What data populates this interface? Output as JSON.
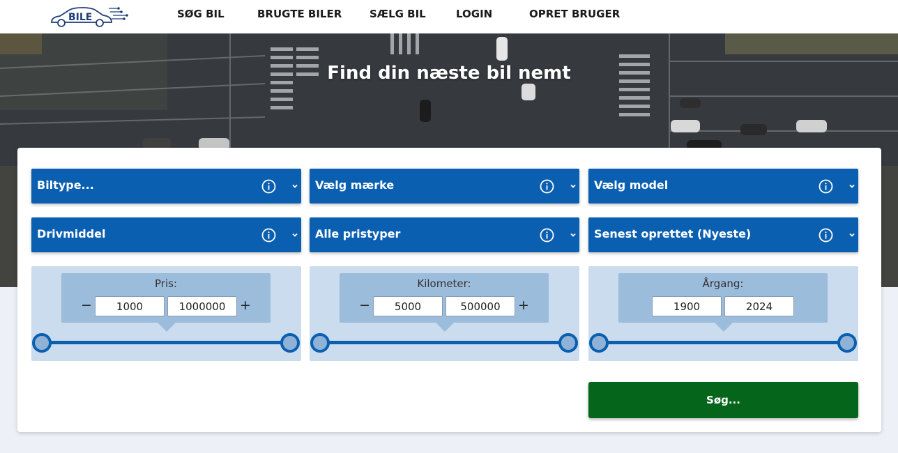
{
  "brand": {
    "logo_text": "BILE"
  },
  "nav": {
    "items": [
      "SØG BIL",
      "BRUGTE BILER",
      "SÆLG BIL",
      "LOGIN",
      "OPRET BRUGER"
    ]
  },
  "hero": {
    "title": "Find din næste bil nemt"
  },
  "filters": {
    "dropdowns": [
      {
        "label": "Biltype..."
      },
      {
        "label": "Vælg mærke"
      },
      {
        "label": "Vælg model"
      },
      {
        "label": "Drivmiddel"
      },
      {
        "label": "Alle pristyper"
      },
      {
        "label": "Senest oprettet (Nyeste)"
      }
    ],
    "ranges": [
      {
        "label": "Pris:",
        "min": "1000",
        "max": "1000000",
        "minus": "−",
        "plus": "+",
        "has_steppers": true
      },
      {
        "label": "Kilometer:",
        "min": "5000",
        "max": "500000",
        "minus": "−",
        "plus": "+",
        "has_steppers": true
      },
      {
        "label": "Årgang:",
        "min": "1900",
        "max": "2024",
        "has_steppers": false
      }
    ]
  },
  "search_button": {
    "label": "Søg..."
  },
  "colors": {
    "primary_blue": "#0a5fb0",
    "search_green": "#05651a",
    "range_bg": "#cadcee",
    "bubble_bg": "#9cbcdc"
  },
  "icons": [
    "car-logo-icon",
    "info-icon",
    "chevron-down-icon"
  ]
}
